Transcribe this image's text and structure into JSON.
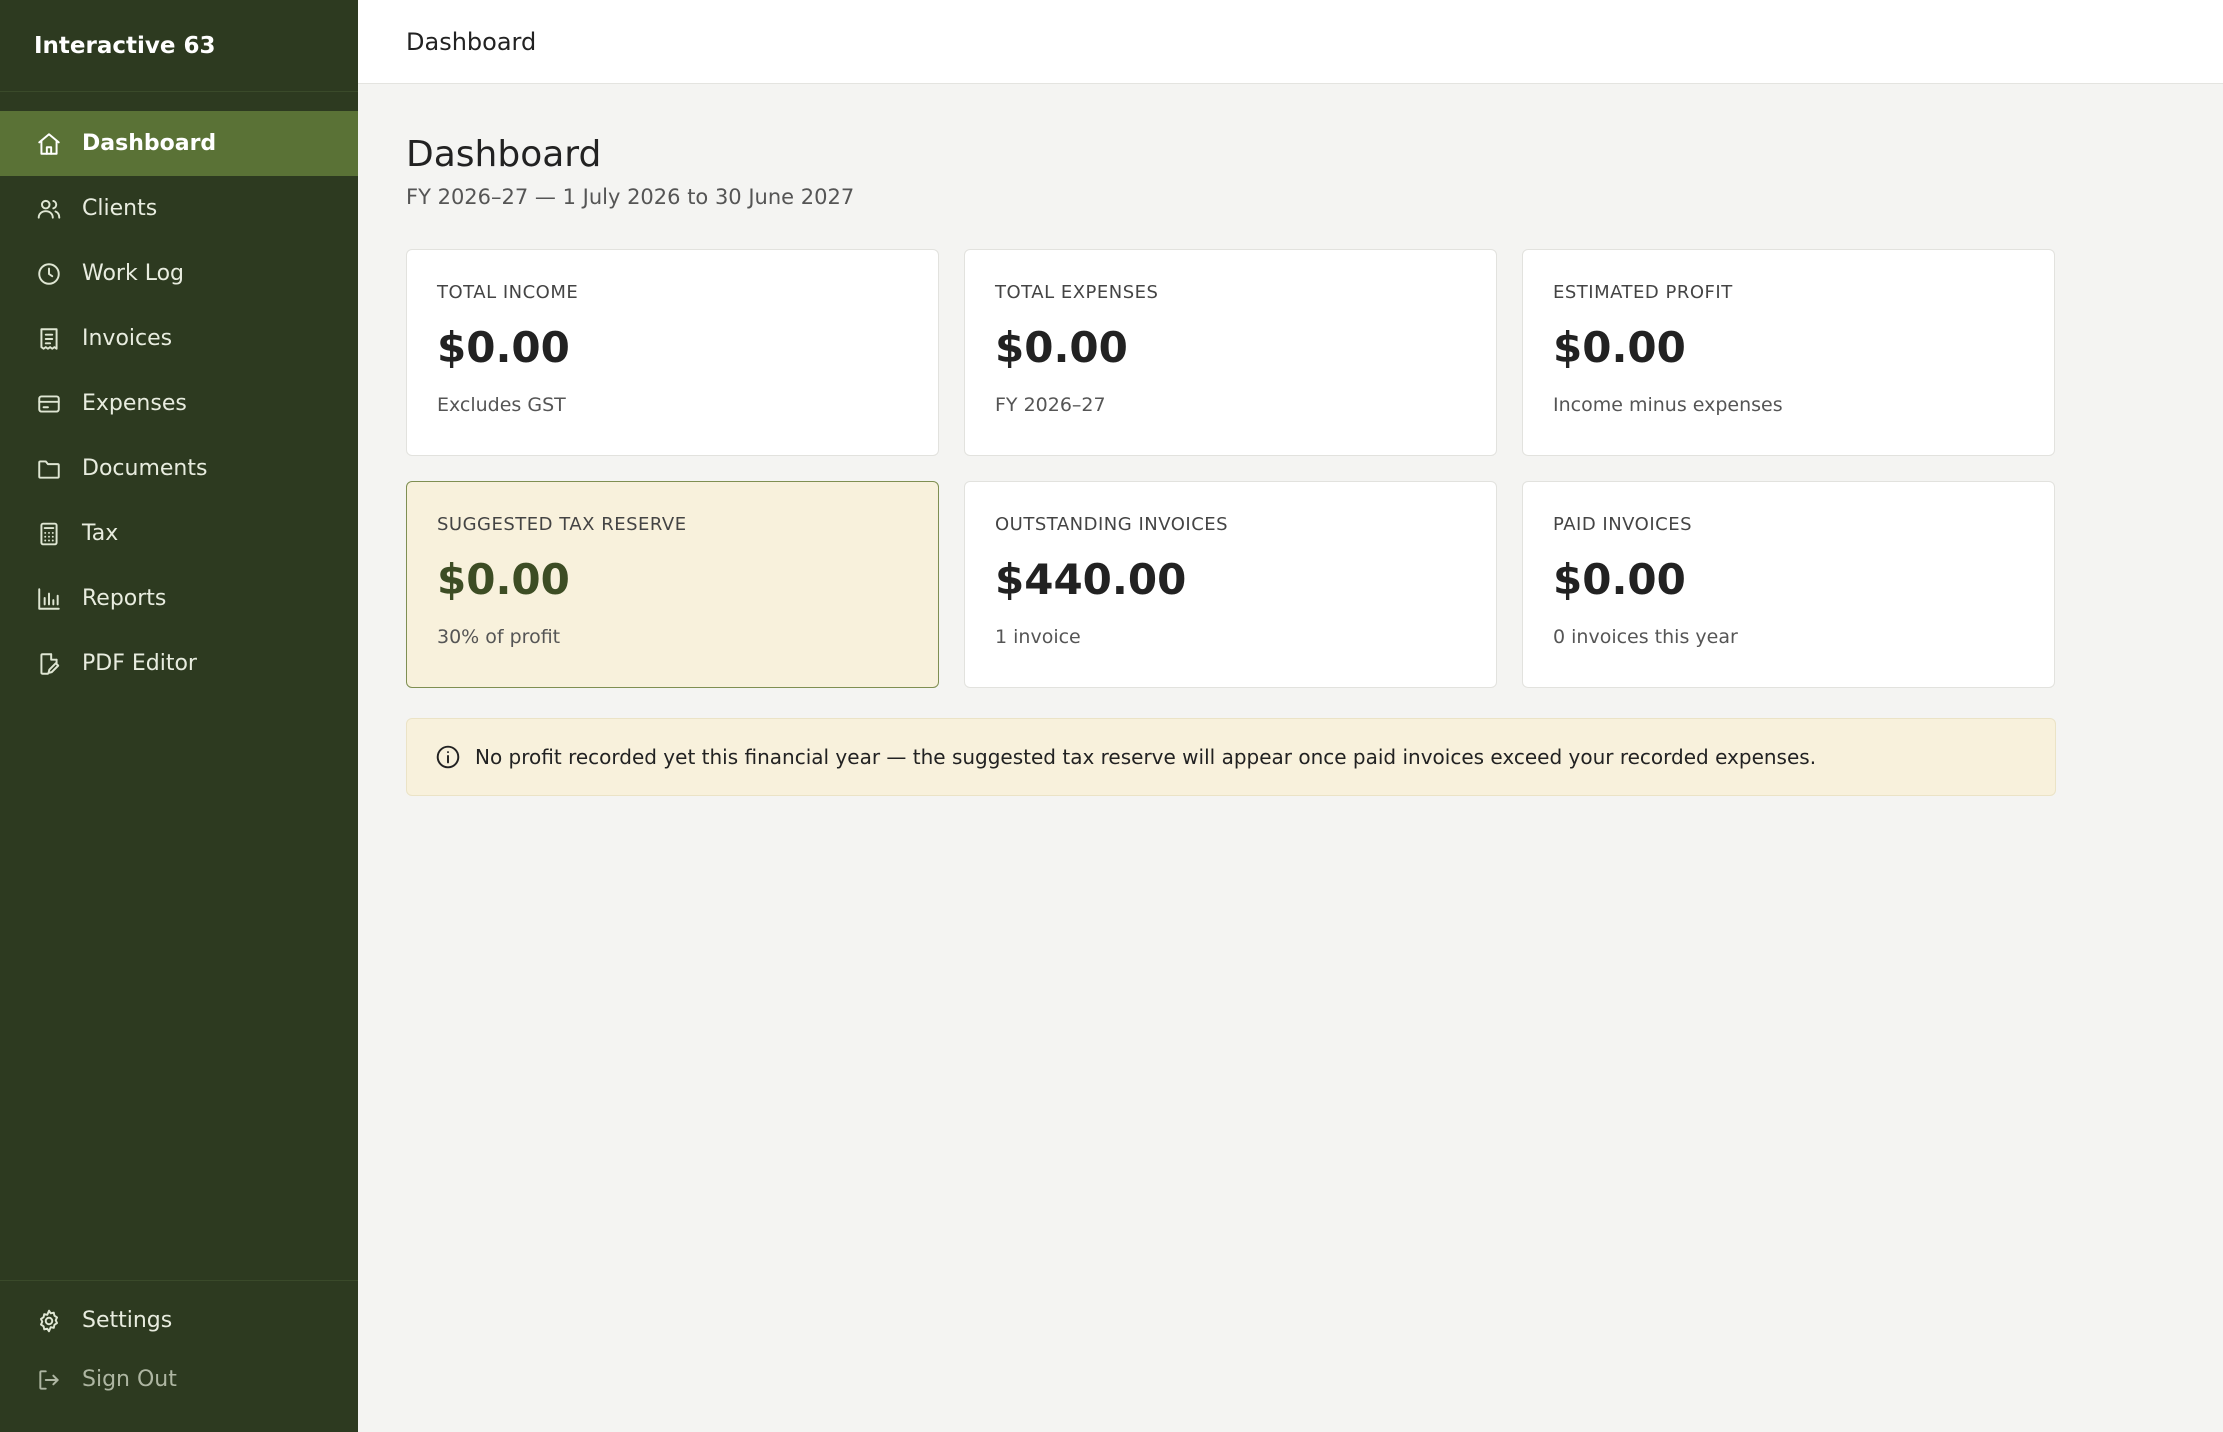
{
  "app": {
    "brand": "Interactive 63"
  },
  "sidebar": {
    "items": [
      {
        "label": "Dashboard",
        "icon": "home-icon",
        "active": true
      },
      {
        "label": "Clients",
        "icon": "users-icon"
      },
      {
        "label": "Work Log",
        "icon": "clock-icon"
      },
      {
        "label": "Invoices",
        "icon": "receipt-icon"
      },
      {
        "label": "Expenses",
        "icon": "credit-card-icon"
      },
      {
        "label": "Documents",
        "icon": "folder-icon"
      },
      {
        "label": "Tax",
        "icon": "calculator-icon"
      },
      {
        "label": "Reports",
        "icon": "bar-chart-icon"
      },
      {
        "label": "PDF Editor",
        "icon": "file-edit-icon"
      }
    ],
    "bottom": [
      {
        "label": "Settings",
        "icon": "gear-icon"
      },
      {
        "label": "Sign Out",
        "icon": "sign-out-icon"
      }
    ]
  },
  "topbar": {
    "title": "Dashboard"
  },
  "main": {
    "title": "Dashboard",
    "subtitle": "FY 2026–27 — 1 July 2026 to 30 June 2027",
    "cards": [
      {
        "label": "TOTAL INCOME",
        "value": "$0.00",
        "note": "Excludes GST"
      },
      {
        "label": "TOTAL EXPENSES",
        "value": "$0.00",
        "note": "FY 2026–27"
      },
      {
        "label": "ESTIMATED PROFIT",
        "value": "$0.00",
        "note": "Income minus expenses"
      },
      {
        "label": "SUGGESTED TAX RESERVE",
        "value": "$0.00",
        "note": "30% of profit",
        "highlight": true
      },
      {
        "label": "OUTSTANDING INVOICES",
        "value": "$440.00",
        "note": "1 invoice"
      },
      {
        "label": "PAID INVOICES",
        "value": "$0.00",
        "note": "0 invoices this year"
      }
    ],
    "notice": {
      "icon": "info-icon",
      "text": "No profit recorded yet this financial year — the suggested tax reserve will appear once paid invoices exceed your recorded expenses."
    }
  },
  "colors": {
    "sidebar_bg": "#2d3a20",
    "active_item_bg": "#5a7236",
    "highlight_card_bg": "#f8f1dc",
    "highlight_card_border": "#7f8f52",
    "page_bg": "#f4f4f2"
  }
}
